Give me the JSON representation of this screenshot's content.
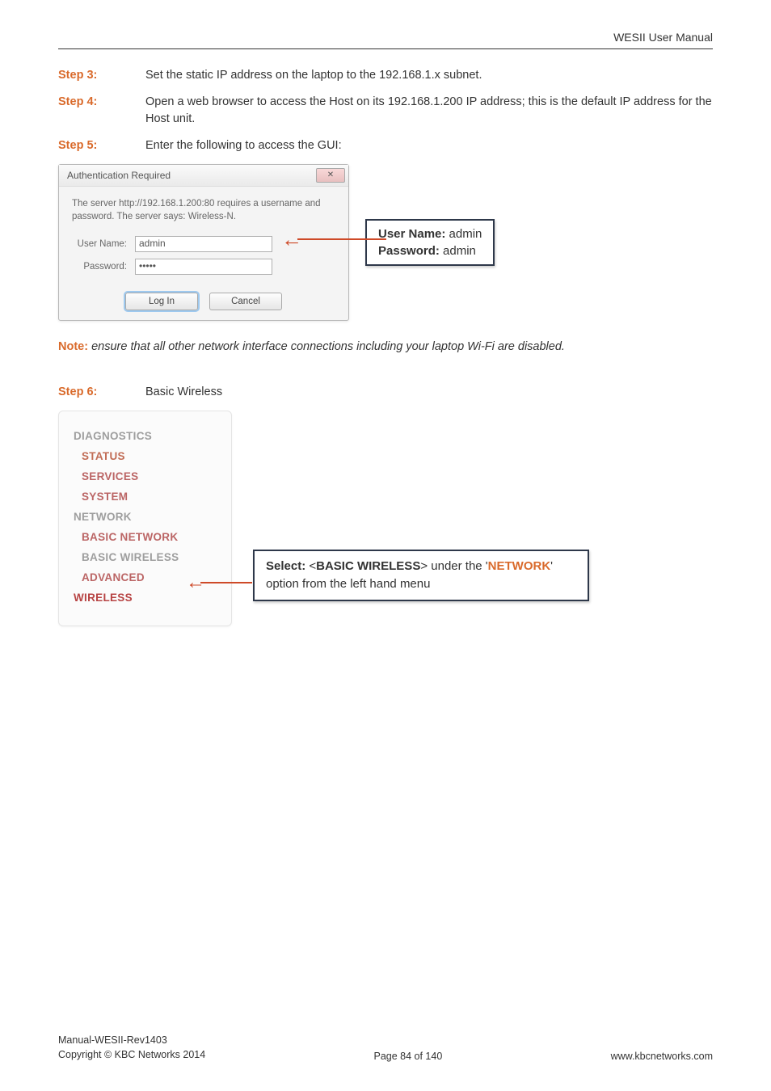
{
  "header": {
    "doc_title": "WESII User Manual"
  },
  "steps": {
    "s3": {
      "label": "Step 3:",
      "text": "Set the static IP address on the laptop to the 192.168.1.x subnet."
    },
    "s4": {
      "label": "Step 4:",
      "text": "Open a web browser to access the Host on its 192.168.1.200 IP address; this is the default IP address for the Host unit."
    },
    "s5": {
      "label": "Step 5:",
      "text": "Enter the following to access the GUI:"
    },
    "s6": {
      "label": "Step 6:",
      "text": "Basic Wireless"
    }
  },
  "auth_dialog": {
    "title": "Authentication Required",
    "close_glyph": "✕",
    "message": "The server http://192.168.1.200:80 requires a username and password. The server says: Wireless-N.",
    "user_label": "User Name:",
    "user_value": "admin",
    "pass_label": "Password:",
    "pass_value": "•••••",
    "login_btn": "Log In",
    "cancel_btn": "Cancel"
  },
  "cred_box": {
    "line1_label": "User Name:",
    "line1_value": " admin",
    "line2_label": "Password:",
    "line2_value": " admin"
  },
  "note": {
    "label": "Note:",
    "text": " ensure that all other network interface connections including your laptop Wi-Fi are disabled."
  },
  "menu": {
    "items": [
      {
        "label": "DIAGNOSTICS",
        "cls": "mi-grey",
        "sub": false
      },
      {
        "label": "STATUS",
        "cls": "mi-brown",
        "sub": true
      },
      {
        "label": "SERVICES",
        "cls": "mi-red-muted",
        "sub": true
      },
      {
        "label": "SYSTEM",
        "cls": "mi-red-muted",
        "sub": true
      },
      {
        "label": "NETWORK",
        "cls": "mi-grey",
        "sub": false
      },
      {
        "label": "BASIC NETWORK",
        "cls": "mi-red-muted",
        "sub": true
      },
      {
        "label": "BASIC WIRELESS",
        "cls": "mi-grey",
        "sub": true
      },
      {
        "label": "ADVANCED",
        "cls": "mi-red-muted",
        "sub": true
      },
      {
        "label": "WIRELESS",
        "cls": "mi-red",
        "sub": false
      }
    ]
  },
  "select_box": {
    "prefix": "Select:  <",
    "bold1": "BASIC WIRELESS",
    "mid1": "> under the '",
    "network": "NETWORK",
    "suffix": "' option from the left hand menu"
  },
  "footer": {
    "line1": "Manual-WESII-Rev1403",
    "line2": "Copyright © KBC Networks 2014",
    "center": "Page 84 of 140",
    "right": "www.kbcnetworks.com"
  }
}
